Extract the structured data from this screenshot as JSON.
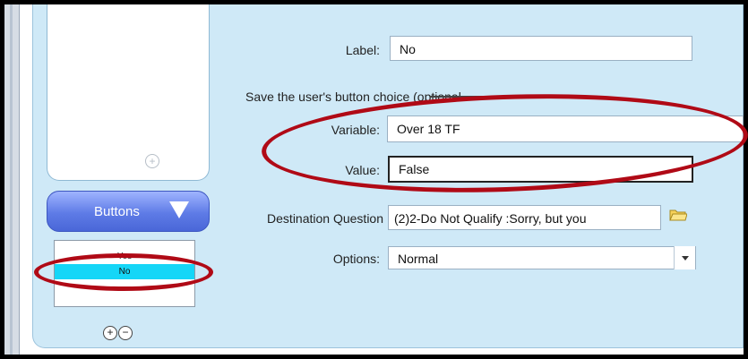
{
  "preview": {
    "add_icon": "plus-icon"
  },
  "buttons_panel": {
    "tab_label": "Buttons",
    "tab_icon": "triangle-down-icon",
    "items": [
      "Yes",
      "No"
    ],
    "selected": "No",
    "controls": [
      {
        "icon": "circle-plus-icon",
        "glyph": "+"
      },
      {
        "icon": "circle-minus-icon",
        "glyph": "−"
      }
    ]
  },
  "form": {
    "label_label": "Label:",
    "label_value": "No",
    "save_text": "Save the user's button choice (optional",
    "variable_label": "Variable:",
    "variable_value": "Over 18 TF",
    "value_label": "Value:",
    "value_value": "False",
    "destination_label": "Destination Question",
    "destination_value": "(2)2-Do Not Qualify :Sorry, but you",
    "destination_icon": "folder-icon",
    "options_label": "Options:",
    "options_value": "Normal"
  },
  "colors": {
    "selected_item": "#15d6f7",
    "panel_bg": "#cfe9f7",
    "annotation": "#b00a16"
  }
}
